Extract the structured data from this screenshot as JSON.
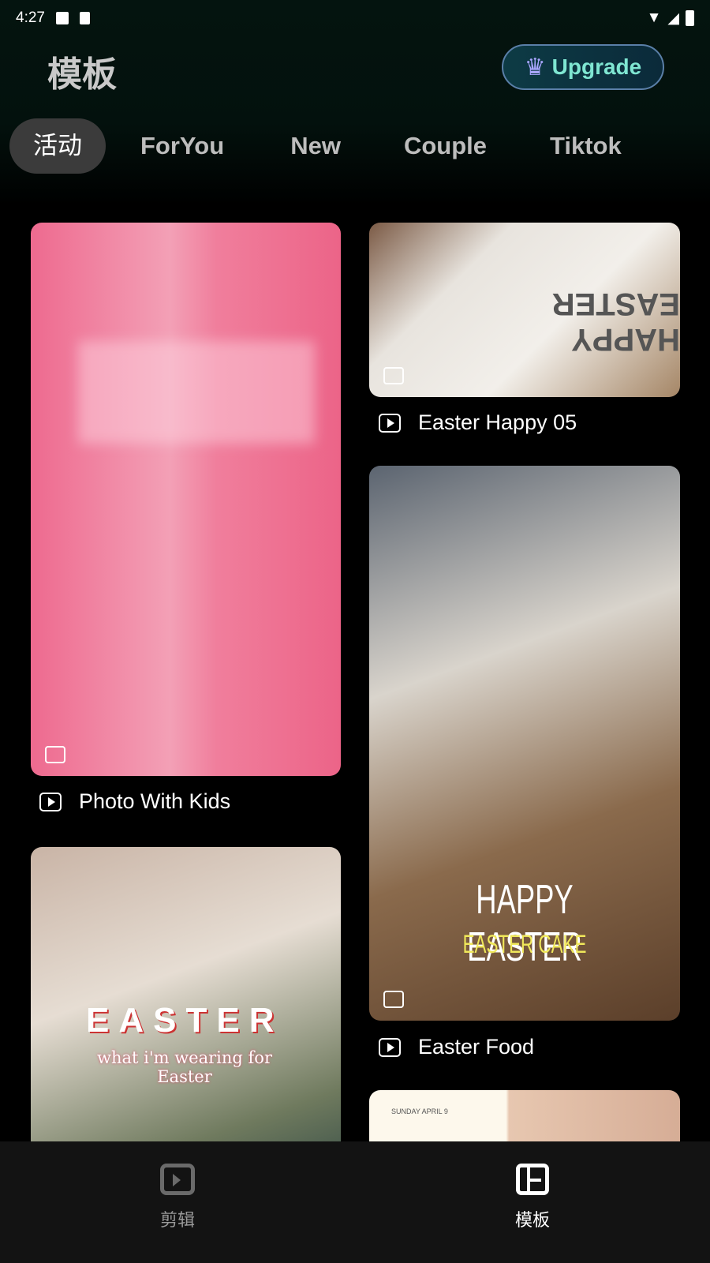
{
  "status": {
    "time": "4:27"
  },
  "header": {
    "title": "模板",
    "upgrade_label": "Upgrade"
  },
  "tabs": [
    {
      "label": "活动",
      "active": true
    },
    {
      "label": "ForYou"
    },
    {
      "label": "New"
    },
    {
      "label": "Couple"
    },
    {
      "label": "Tiktok"
    }
  ],
  "templates": [
    {
      "title": "Photo With Kids",
      "overlay_text": ""
    },
    {
      "title": "Easter Happy 05",
      "overlay_text": "HAPPY EASTER"
    },
    {
      "title": "Easter Food",
      "overlay_text": "HAPPY EASTER",
      "overlay_sub": "EASTER CAKE"
    },
    {
      "title": "",
      "overlay_text": "EASTER",
      "overlay_sub": "what i'm wearing for Easter"
    },
    {
      "title": "",
      "overlay_text": "SUNDAY APRIL 9"
    }
  ],
  "nav": [
    {
      "label": "剪辑",
      "icon": "edit-video-icon"
    },
    {
      "label": "模板",
      "icon": "template-icon",
      "active": true
    }
  ]
}
